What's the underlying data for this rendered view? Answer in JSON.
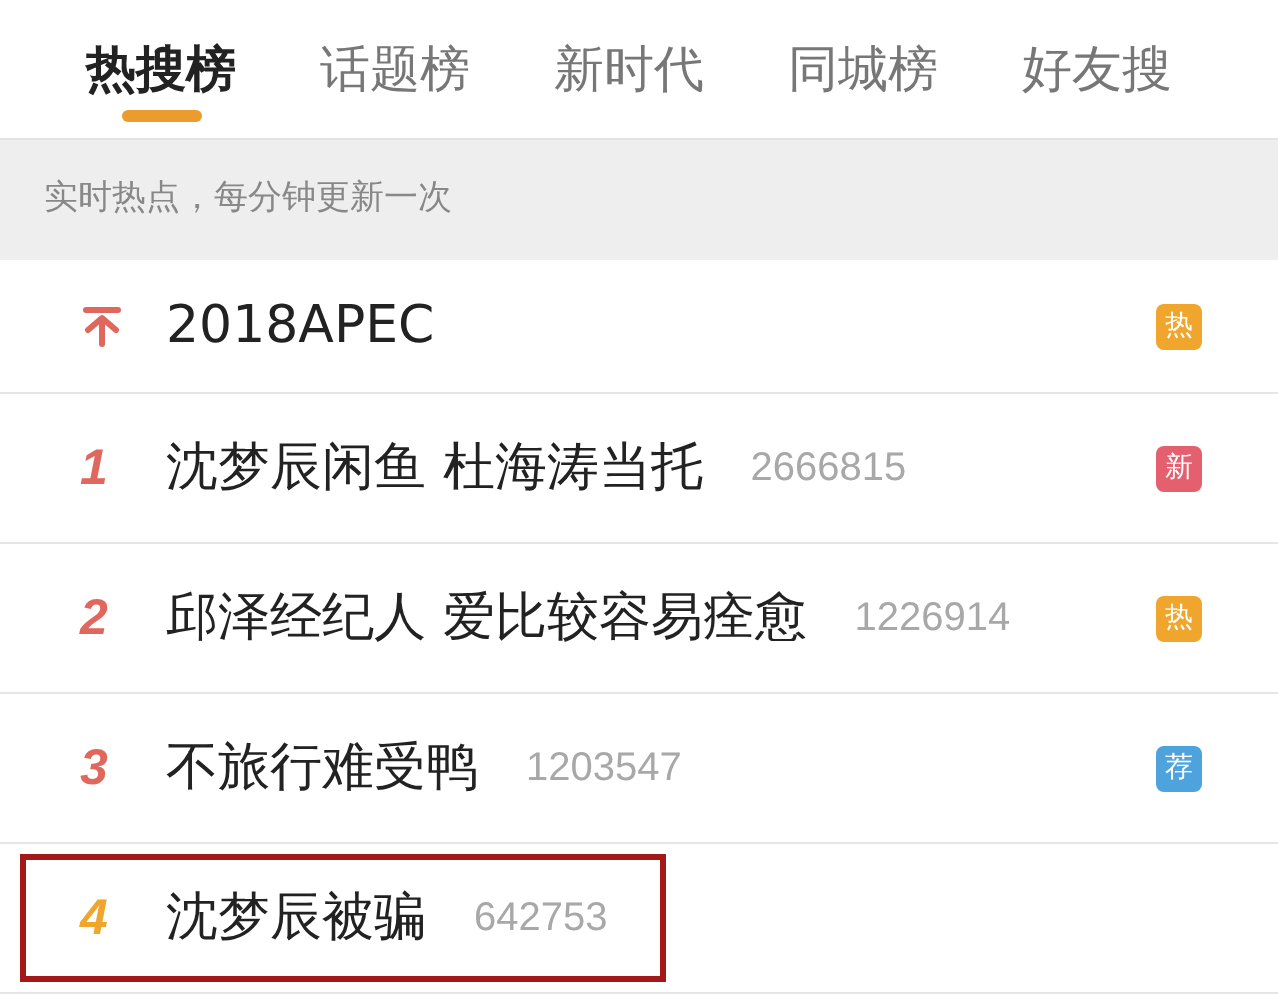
{
  "tabs": [
    {
      "label": "热搜榜",
      "selected": true
    },
    {
      "label": "话题榜",
      "selected": false
    },
    {
      "label": "新时代",
      "selected": false
    },
    {
      "label": "同城榜",
      "selected": false
    },
    {
      "label": "好友搜",
      "selected": false
    }
  ],
  "notice": "实时热点，每分钟更新一次",
  "rows": [
    {
      "kind": "pinned",
      "title": "2018APEC",
      "badge": {
        "label": "热",
        "color": "#f0a52c"
      },
      "highlighted": false
    },
    {
      "kind": "numbered",
      "rank": "1",
      "color": "#e0675d",
      "title": "沈梦辰闲鱼 杜海涛当托",
      "count": "2666815",
      "badge": {
        "label": "新",
        "color": "#e5606f"
      },
      "highlighted": false
    },
    {
      "kind": "numbered",
      "rank": "2",
      "color": "#e0675d",
      "title": "邱泽经纪人 爱比较容易痊愈",
      "count": "1226914",
      "badge": {
        "label": "热",
        "color": "#f0a52c"
      },
      "highlighted": false
    },
    {
      "kind": "numbered",
      "rank": "3",
      "color": "#e0675d",
      "title": "不旅行难受鸭",
      "count": "1203547",
      "badge": {
        "label": "荐",
        "color": "#4ea3dc"
      },
      "highlighted": false
    },
    {
      "kind": "numbered",
      "rank": "4",
      "color": "#f0a52c",
      "title": "沈梦辰被骗",
      "count": "642753",
      "highlighted": true
    }
  ]
}
